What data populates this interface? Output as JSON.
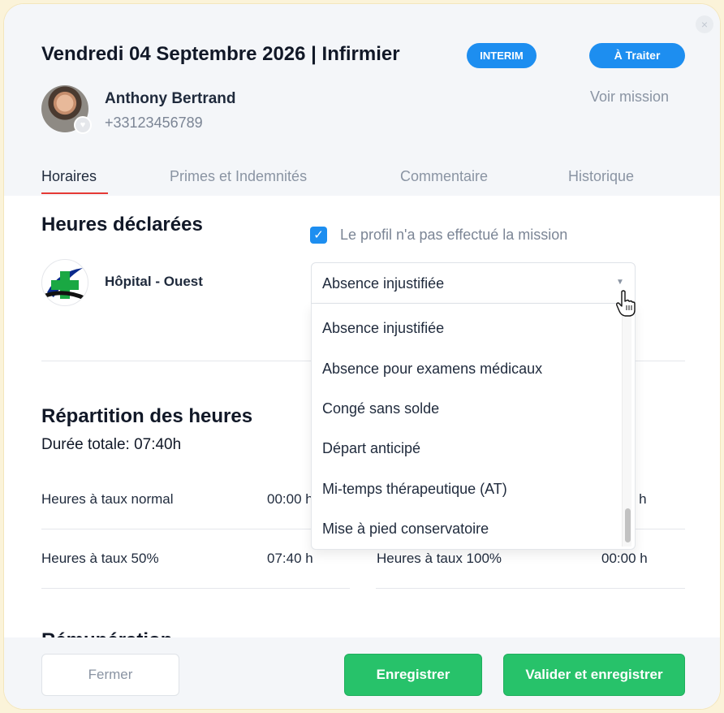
{
  "header": {
    "title": "Vendredi 04 Septembre 2026 | Infirmier",
    "type_badge": "INTERIM",
    "status_badge": "À Traiter",
    "close_symbol": "×",
    "voir_mission": "Voir mission"
  },
  "person": {
    "name": "Anthony Bertrand",
    "phone": "+33123456789"
  },
  "tabs": [
    {
      "label": "Horaires",
      "active": true
    },
    {
      "label": "Primes et Indemnités",
      "active": false
    },
    {
      "label": "Commentaire",
      "active": false
    },
    {
      "label": "Historique",
      "active": false
    }
  ],
  "heures": {
    "title": "Heures déclarées",
    "checkbox_label": "Le profil n'a pas effectué la mission",
    "checkbox_checked": true,
    "hospital": "Hôpital - Ouest",
    "select_value": "Absence injustifiée"
  },
  "dropdown": {
    "options": [
      "Absence injustifiée",
      "Absence pour examens médicaux",
      "Congé sans solde",
      "Départ anticipé",
      "Mi-temps thérapeutique (AT)",
      "Mise à pied conservatoire"
    ]
  },
  "repartition": {
    "title": "Répartition des heures",
    "duree": "Durée totale: 07:40h",
    "rows": [
      {
        "label": "Heures à taux normal",
        "value": "00:00 h"
      },
      {
        "label": "Heures à taux 50%",
        "value": "07:40 h"
      },
      {
        "label": "Heures à taux 100%",
        "value": "00:00 h"
      },
      {
        "label": "",
        "value": "0 h"
      }
    ]
  },
  "next_section_title": "Rémunération",
  "footer": {
    "fermer": "Fermer",
    "enregistrer": "Enregistrer",
    "valider": "Valider et enregistrer"
  },
  "colors": {
    "primary_blue": "#1d8ef0",
    "green": "#27c26a",
    "tab_underline": "#e53935"
  }
}
